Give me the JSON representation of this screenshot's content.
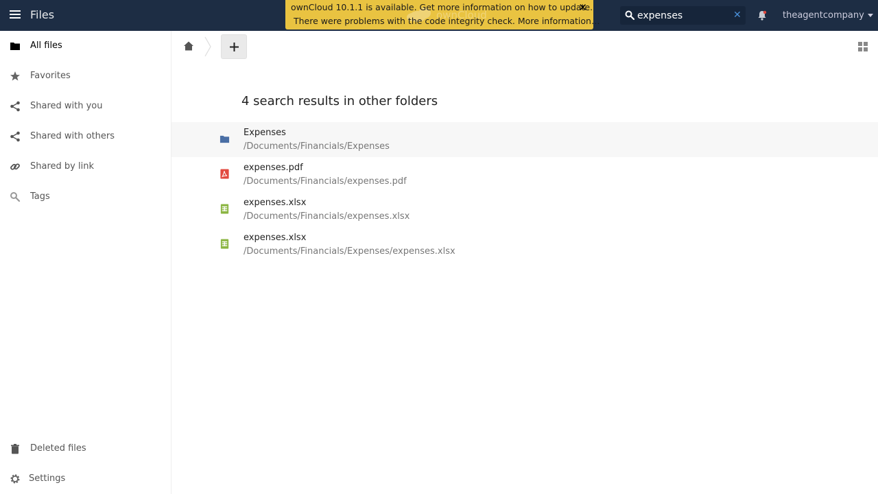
{
  "header": {
    "app_name": "Files",
    "user_name": "theagentcompany",
    "logo_text": "ownCloud"
  },
  "banner": {
    "line1": "ownCloud 10.1.1 is available. Get more information on how to update.",
    "line2": "There were problems with the code integrity check. More information…",
    "close_glyph": "✕",
    "color": "#e9c341"
  },
  "search": {
    "value": "expenses",
    "clear_glyph": "✕"
  },
  "sidebar": {
    "items": [
      {
        "label": "All files",
        "icon": "folder-icon"
      },
      {
        "label": "Favorites",
        "icon": "star-icon"
      },
      {
        "label": "Shared with you",
        "icon": "share-icon"
      },
      {
        "label": "Shared with others",
        "icon": "share-icon"
      },
      {
        "label": "Shared by link",
        "icon": "link-icon"
      },
      {
        "label": "Tags",
        "icon": "tag-search-icon"
      }
    ],
    "bottom_items": [
      {
        "label": "Deleted files",
        "icon": "trash-icon"
      },
      {
        "label": "Settings",
        "icon": "gear-icon"
      }
    ]
  },
  "results": {
    "title": "4 search results in other folders",
    "rows": [
      {
        "name": "Expenses",
        "path": "/Documents/Financials/Expenses",
        "icon": "folder-icon",
        "icon_color": "#4a6fa5"
      },
      {
        "name": "expenses.pdf",
        "path": "/Documents/Financials/expenses.pdf",
        "icon": "pdf-icon",
        "icon_color": "#e2493f"
      },
      {
        "name": "expenses.xlsx",
        "path": "/Documents/Financials/expenses.xlsx",
        "icon": "spreadsheet-icon",
        "icon_color": "#8bb542"
      },
      {
        "name": "expenses.xlsx",
        "path": "/Documents/Financials/Expenses/expenses.xlsx",
        "icon": "spreadsheet-icon",
        "icon_color": "#8bb542"
      }
    ]
  },
  "colors": {
    "header_bg": "#1d2d44",
    "accent": "#4a90d9"
  }
}
